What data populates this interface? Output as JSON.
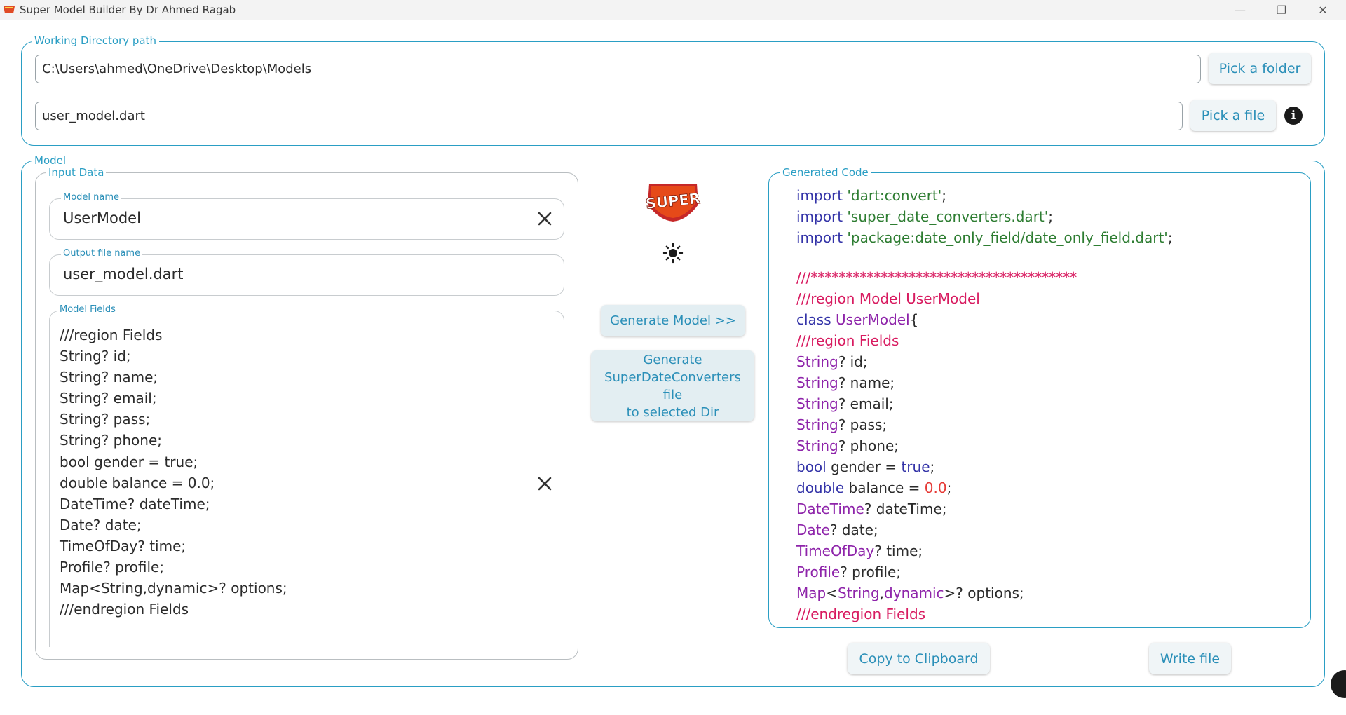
{
  "window": {
    "title": "Super Model Builder By Dr Ahmed Ragab",
    "minimize": "—",
    "restore": "❐",
    "close": "✕"
  },
  "working_dir": {
    "legend": "Working Directory path",
    "path_value": "C:\\Users\\ahmed\\OneDrive\\Desktop\\Models",
    "pick_folder_label": "Pick a folder",
    "file_value": "user_model.dart",
    "pick_file_label": "Pick a file",
    "info_icon": "i"
  },
  "model": {
    "legend": "Model",
    "input_data": {
      "legend": "Input Data",
      "model_name_label": "Model name",
      "model_name_value": "UserModel",
      "output_file_label": "Output file name",
      "output_file_value": "user_model.dart",
      "model_fields_label": "Model Fields",
      "model_fields_lines": [
        "///region Fields",
        "String? id;",
        "String? name;",
        "String? email;",
        "String? pass;",
        "String? phone;",
        "bool gender = true;",
        "double balance = 0.0;",
        "DateTime? dateTime;",
        "Date? date;",
        "TimeOfDay? time;",
        "Profile? profile;",
        "Map<String,dynamic>? options;",
        "///endregion Fields"
      ]
    },
    "middle": {
      "logo_text": "SUPER",
      "theme_icon": "sun-icon",
      "generate_model_label": "Generate Model >>",
      "generate_converters_lines": [
        "Generate",
        "SuperDateConverters",
        "file",
        "to selected Dir"
      ]
    },
    "generated_code": {
      "legend": "Generated Code",
      "lines": [
        [
          [
            "import ",
            "kw"
          ],
          [
            "'dart:convert'",
            "str"
          ],
          [
            ";",
            "plain"
          ]
        ],
        [
          [
            "import ",
            "kw"
          ],
          [
            "'super_date_converters.dart'",
            "str"
          ],
          [
            ";",
            "plain"
          ]
        ],
        [
          [
            "import ",
            "kw"
          ],
          [
            "'package:date_only_field/date_only_field.dart'",
            "str"
          ],
          [
            ";",
            "plain"
          ]
        ],
        [
          [
            "",
            "plain"
          ]
        ],
        [
          [
            "///**************************************",
            "cmt"
          ]
        ],
        [
          [
            "///region Model UserModel",
            "cmt"
          ]
        ],
        [
          [
            "class ",
            "kw"
          ],
          [
            "UserModel",
            "type"
          ],
          [
            "{",
            "plain"
          ]
        ],
        [
          [
            "///region Fields",
            "cmt"
          ]
        ],
        [
          [
            "String",
            "type"
          ],
          [
            "? id;",
            "plain"
          ]
        ],
        [
          [
            "String",
            "type"
          ],
          [
            "? name;",
            "plain"
          ]
        ],
        [
          [
            "String",
            "type"
          ],
          [
            "? email;",
            "plain"
          ]
        ],
        [
          [
            "String",
            "type"
          ],
          [
            "? pass;",
            "plain"
          ]
        ],
        [
          [
            "String",
            "type"
          ],
          [
            "? phone;",
            "plain"
          ]
        ],
        [
          [
            "bool ",
            "kw"
          ],
          [
            "gender = ",
            "plain"
          ],
          [
            "true",
            "kw"
          ],
          [
            ";",
            "plain"
          ]
        ],
        [
          [
            "double ",
            "kw"
          ],
          [
            "balance = ",
            "plain"
          ],
          [
            "0.0",
            "num"
          ],
          [
            ";",
            "plain"
          ]
        ],
        [
          [
            "DateTime",
            "type"
          ],
          [
            "? dateTime;",
            "plain"
          ]
        ],
        [
          [
            "Date",
            "type"
          ],
          [
            "? date;",
            "plain"
          ]
        ],
        [
          [
            "TimeOfDay",
            "type"
          ],
          [
            "? time;",
            "plain"
          ]
        ],
        [
          [
            "Profile",
            "type"
          ],
          [
            "? profile;",
            "plain"
          ]
        ],
        [
          [
            "Map",
            "type"
          ],
          [
            "<",
            "plain"
          ],
          [
            "String",
            "type"
          ],
          [
            ",",
            "plain"
          ],
          [
            "dynamic",
            "type"
          ],
          [
            ">? options;",
            "plain"
          ]
        ],
        [
          [
            "///endregion Fields",
            "cmt"
          ]
        ]
      ]
    },
    "copy_label": "Copy to Clipboard",
    "write_label": "Write file"
  }
}
